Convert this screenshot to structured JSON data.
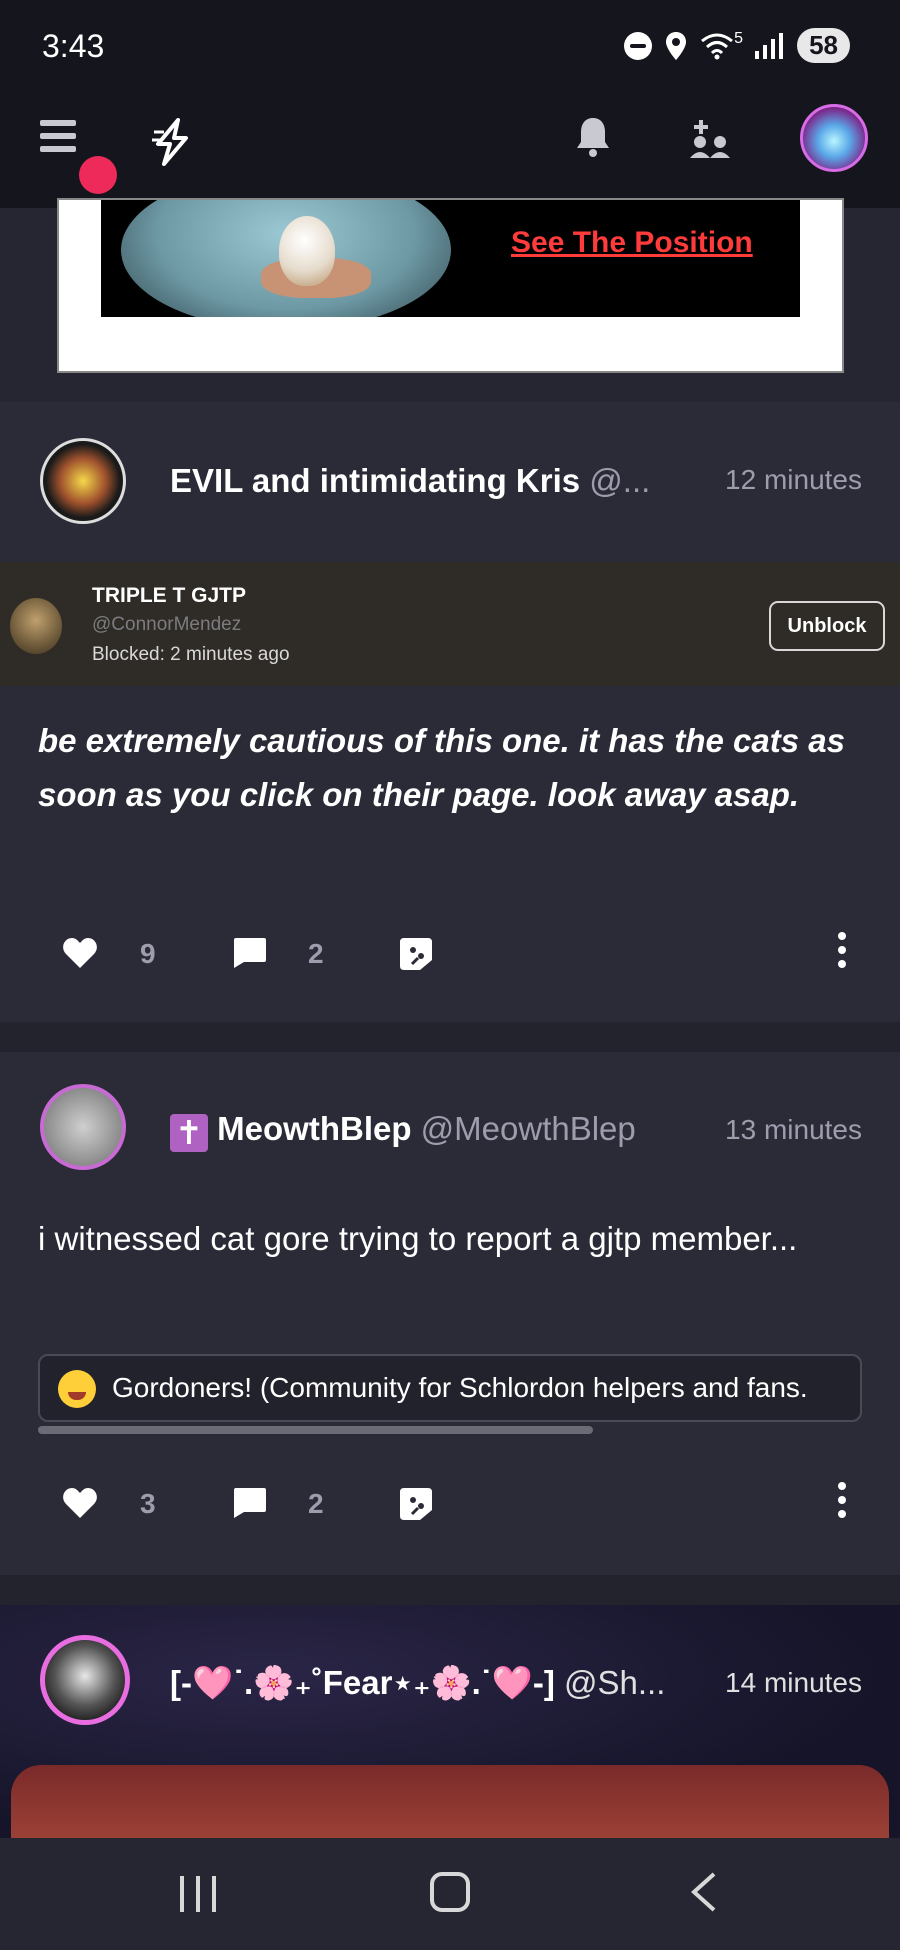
{
  "status_bar": {
    "time": "3:43",
    "battery": "58",
    "network": "5"
  },
  "nav": {
    "menu_icon": "hamburger-icon",
    "home_icon": "lightning-bolt-icon",
    "bell_icon": "bell-icon",
    "people_icon": "add-people-icon",
    "accent": "#3aa3ff",
    "notification_color": "#ee2a5b"
  },
  "ad": {
    "link_text": "See The Position"
  },
  "posts": [
    {
      "author": "EVIL and intimidating Kris",
      "handle": "@...",
      "time": "12 minutes",
      "blocked": {
        "name": "TRIPLE T GJTP",
        "handle": "@ConnorMendez",
        "blocked_text": "Blocked: 2 minutes ago",
        "unblock_label": "Unblock"
      },
      "body": "be extremely cautious of this one. it has the cats as soon as you click on their page. look away asap.",
      "likes": "9",
      "comments": "2"
    },
    {
      "badge": "✝",
      "author": "MeowthBlep",
      "handle": "@MeowthBlep",
      "time": "13 minutes",
      "body": "i witnessed cat gore trying to report a gjtp member...",
      "community": "Gordoners! (Community for Schlordon helpers and fans.",
      "likes": "3",
      "comments": "2"
    },
    {
      "author": "[-🩷˙.🌸₊˚Fear⋆₊🌸.˙🩷-]",
      "handle": "@Sh...",
      "time": "14 minutes"
    }
  ]
}
